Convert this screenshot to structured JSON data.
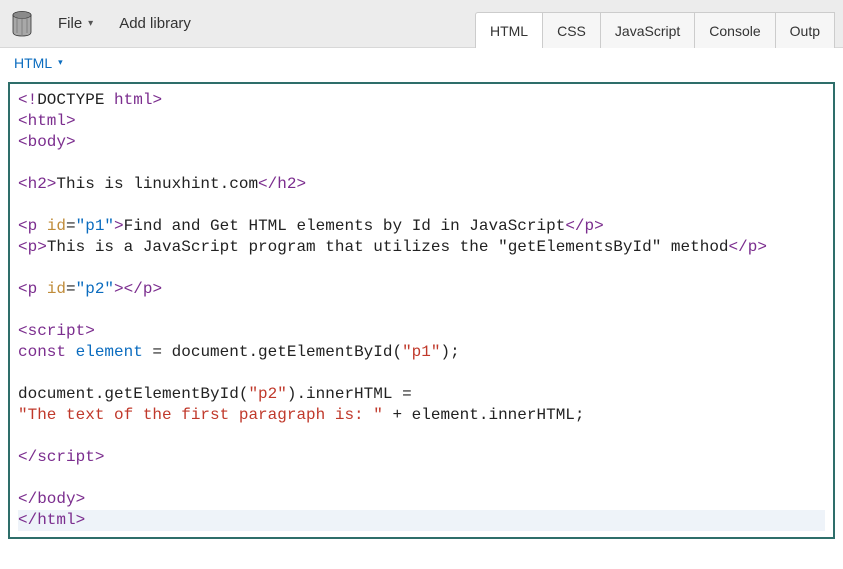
{
  "toolbar": {
    "file_label": "File",
    "add_library_label": "Add library"
  },
  "panel_tabs": {
    "html": "HTML",
    "css": "CSS",
    "javascript": "JavaScript",
    "console": "Console",
    "output": "Outp"
  },
  "sub_toolbar": {
    "html_dropdown": "HTML"
  },
  "code": {
    "l1_doctype_open": "<!",
    "l1_doctype_word": "DOCTYPE",
    "l1_doctype_html": " html",
    "l1_doctype_close": ">",
    "l2_html_open": "<html>",
    "l3_body_open": "<body>",
    "l5_h2_open": "<h2>",
    "l5_h2_text": "This is linuxhint.com",
    "l5_h2_close": "</h2>",
    "l7_p_open": "<p",
    "l7_space": " ",
    "l7_attr_id": "id",
    "l7_eq": "=",
    "l7_val_p1": "\"p1\"",
    "l7_gt": ">",
    "l7_text": "Find and Get HTML elements by Id in JavaScript",
    "l7_p_close": "</p>",
    "l8_p_open": "<p>",
    "l8_text": "This is a JavaScript program that utilizes the \"getElementsById\" method",
    "l8_p_close": "</p>",
    "l10_p_open": "<p",
    "l10_space": " ",
    "l10_attr_id": "id",
    "l10_eq": "=",
    "l10_val_p2": "\"p2\"",
    "l10_gt": ">",
    "l10_p_close": "</p>",
    "l12_script_open": "<script>",
    "l13_const": "const",
    "l13_var": " element",
    "l13_rest": " = document.getElementById(",
    "l13_arg": "\"p1\"",
    "l13_end": ");",
    "l15_left": "document.getElementById(",
    "l15_arg": "\"p2\"",
    "l15_right": ").innerHTML =",
    "l16_str": "\"The text of the first paragraph is: \"",
    "l16_rest": " + element.innerHTML;",
    "l18_script_close": "</scr",
    "l18_script_close2": "ipt>",
    "l20_body_close": "</body>",
    "l21_html_close": "</html>"
  }
}
